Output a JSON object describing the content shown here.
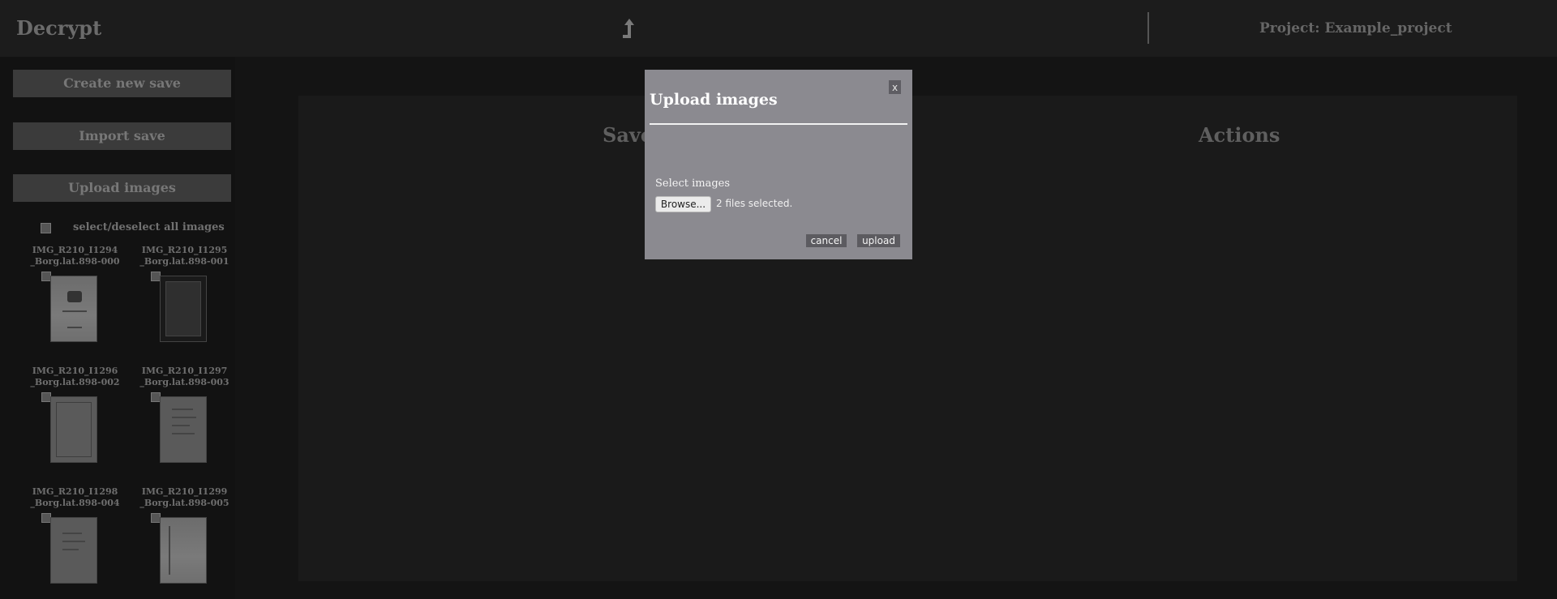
{
  "header": {
    "brand": "Decrypt",
    "up_icon": "arrow-up-icon",
    "project_label": "Project: Example_project"
  },
  "sidebar": {
    "create_save": "Create new save",
    "import_save": "Import save",
    "upload_images": "Upload images",
    "select_all_label": "select/deselect all images",
    "images": [
      {
        "line1": "IMG_R210_I1294",
        "line2": "_Borg.lat.898-000"
      },
      {
        "line1": "IMG_R210_I1295",
        "line2": "_Borg.lat.898-001"
      },
      {
        "line1": "IMG_R210_I1296",
        "line2": "_Borg.lat.898-002"
      },
      {
        "line1": "IMG_R210_I1297",
        "line2": "_Borg.lat.898-003"
      },
      {
        "line1": "IMG_R210_I1298",
        "line2": "_Borg.lat.898-004"
      },
      {
        "line1": "IMG_R210_I1299",
        "line2": "_Borg.lat.898-005"
      }
    ]
  },
  "main": {
    "saves_heading": "Saves",
    "actions_heading": "Actions"
  },
  "modal": {
    "title": "Upload images",
    "close_label": "x",
    "select_label": "Select images",
    "browse_label": "Browse...",
    "file_status": "2 files selected.",
    "cancel_label": "cancel",
    "upload_label": "upload"
  }
}
